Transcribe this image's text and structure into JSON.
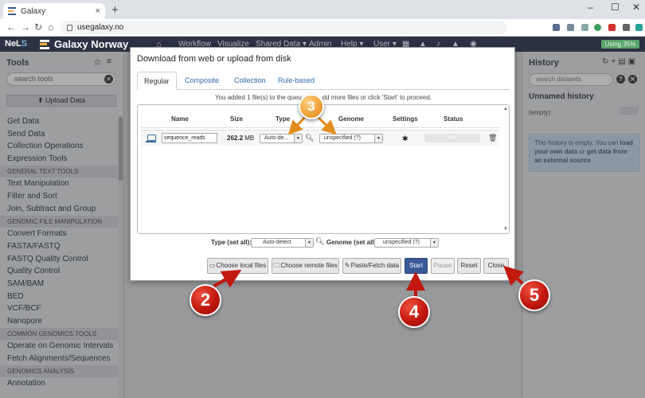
{
  "browser": {
    "tab_title": "Galaxy",
    "tab_close": "×",
    "new_tab": "+",
    "url": "usegalaxy.no",
    "win_min": "–",
    "win_max": "☐",
    "win_close": "✕"
  },
  "masthead": {
    "nels_prefix": "NeL",
    "nels_suffix": "S",
    "brand": "Galaxy Norway",
    "nav": [
      "Workflow",
      "Visualize",
      "Shared Data ▾",
      "Admin",
      "Help ▾",
      "User ▾"
    ],
    "usage": "Using 35%"
  },
  "tools": {
    "title": "Tools",
    "search_placeholder": "search tools",
    "upload_label": "Upload Data",
    "items": [
      {
        "label": "Get Data",
        "section": false
      },
      {
        "label": "Send Data",
        "section": false
      },
      {
        "label": "Collection Operations",
        "section": false
      },
      {
        "label": "Expression Tools",
        "section": false
      },
      {
        "label": "GENERAL TEXT TOOLS",
        "section": true
      },
      {
        "label": "Text Manipulation",
        "section": false
      },
      {
        "label": "Filter and Sort",
        "section": false
      },
      {
        "label": "Join, Subtract and Group",
        "section": false
      },
      {
        "label": "GENOMIC FILE MANIPULATION",
        "section": true
      },
      {
        "label": "Convert Formats",
        "section": false
      },
      {
        "label": "FASTA/FASTQ",
        "section": false
      },
      {
        "label": "FASTQ Quality Control",
        "section": false
      },
      {
        "label": "Quality Control",
        "section": false
      },
      {
        "label": "SAM/BAM",
        "section": false
      },
      {
        "label": "BED",
        "section": false
      },
      {
        "label": "VCF/BCF",
        "section": false
      },
      {
        "label": "Nanopore",
        "section": false
      },
      {
        "label": "COMMON GENOMICS TOOLS",
        "section": true
      },
      {
        "label": "Operate on Genomic Intervals",
        "section": false
      },
      {
        "label": "Fetch Alignments/Sequences",
        "section": false
      },
      {
        "label": "GENOMICS ANALYSIS",
        "section": true
      },
      {
        "label": "Annotation",
        "section": false
      }
    ]
  },
  "history": {
    "title": "History",
    "search_placeholder": "search datasets",
    "name": "Unnamed history",
    "empty": "(empty)",
    "info_prefix": "This history is empty. You can ",
    "info_link1": "load your own data",
    "info_mid": " or ",
    "info_link2": "get data from an external source"
  },
  "modal": {
    "title": "Download from web or upload from disk",
    "tabs": [
      "Regular",
      "Composite",
      "Collection",
      "Rule-based"
    ],
    "message_left": "You added 1 file(s) to the queu",
    "message_right": "dd more files or click 'Start' to proceed.",
    "columns": {
      "name": "Name",
      "size": "Size",
      "type": "Type",
      "genome": "Genome",
      "settings": "Settings",
      "status": "Status"
    },
    "row": {
      "name": "sequence_reads",
      "size_value": "262.2",
      "size_unit": "MB",
      "type": "Auto-de...",
      "genome": "unspecified (?)",
      "progress": "0%"
    },
    "type_set_all_label": "Type (set all):",
    "type_set_all_value": "Auto-detect",
    "genome_set_all_label": "Genome (set all):",
    "genome_set_all_value": "unspecified (?)",
    "buttons": {
      "local": "Choose local files",
      "remote": "Choose remote files",
      "paste": "Paste/Fetch data",
      "start": "Start",
      "pause": "Pause",
      "reset": "Reset",
      "close": "Close"
    }
  },
  "annotations": {
    "two": "2",
    "three": "3",
    "four": "4",
    "five": "5"
  },
  "colors": {
    "masthead": "#2c3143",
    "primary_button": "#3b5998",
    "badge_red": "#c2180e",
    "badge_orange": "#f3a43a"
  }
}
